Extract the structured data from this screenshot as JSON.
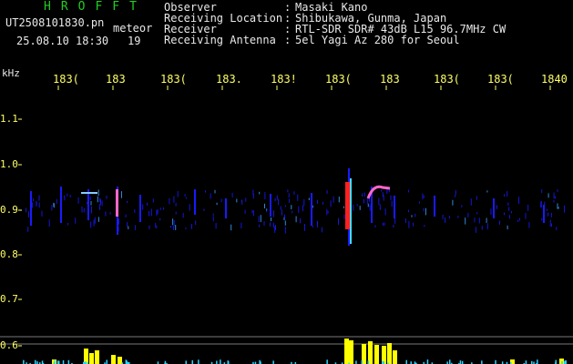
{
  "header": {
    "brand": "HROFFT",
    "file_name": "UT2508101830.pn",
    "tag": "meteor",
    "datetime": "25.08.10 18:30",
    "count": "19"
  },
  "meta": [
    {
      "key": "Observer",
      "value": "Masaki Kano"
    },
    {
      "key": "Receiving Location",
      "value": "Shibukawa, Gunma, Japan"
    },
    {
      "key": "Receiver",
      "value": "RTL-SDR SDR# 43dB L15 96.7MHz CW"
    },
    {
      "key": "Receiving Antenna",
      "value": "5el Yagi Az 280 for Seoul"
    }
  ],
  "axes": {
    "y_unit": "kHz",
    "x_ticks": [
      "183(",
      "183",
      "183(",
      "183.",
      "183!",
      "183(",
      "183",
      "183(",
      "183(",
      "1840"
    ],
    "y_ticks": [
      "1.1",
      "1.0",
      "0.9",
      "0.8",
      "0.7",
      "0.6"
    ]
  },
  "colors": {
    "background": "#000000",
    "axis_text": "#ffff66",
    "brand": "#22cc22",
    "text": "#e8e8e8",
    "signal_low": "#1a1aff",
    "signal_high": "#ff2020",
    "level_bars": "#ffff00"
  }
}
